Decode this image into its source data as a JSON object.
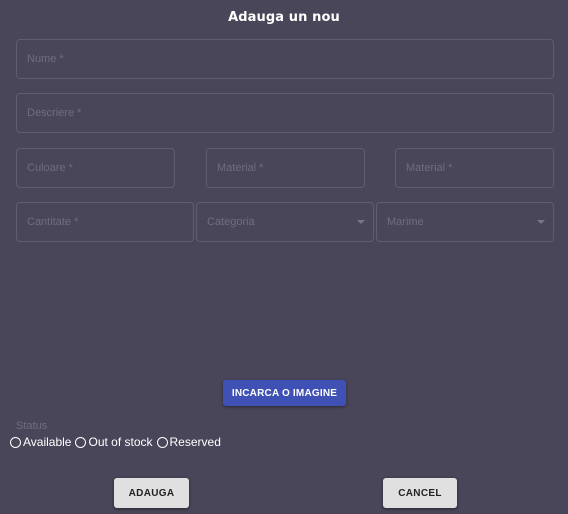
{
  "dialog": {
    "title": "Adauga un nou"
  },
  "fields": {
    "nume": "Nume *",
    "descriere": "Descriere *",
    "culoare": "Culoare *",
    "material1": "Material *",
    "material2": "Material *",
    "cantitate": "Cantitate *",
    "categoria": "Categoria",
    "marime": "Marime"
  },
  "upload_button": "INCARCA O IMAGINE",
  "status": {
    "label": "Status",
    "options": [
      "Available",
      "Out of stock",
      "Reserved"
    ]
  },
  "buttons": {
    "add": "ADAUGA",
    "cancel": "CANCEL"
  },
  "colors": {
    "background": "#484658",
    "accent": "#3f51b5"
  }
}
